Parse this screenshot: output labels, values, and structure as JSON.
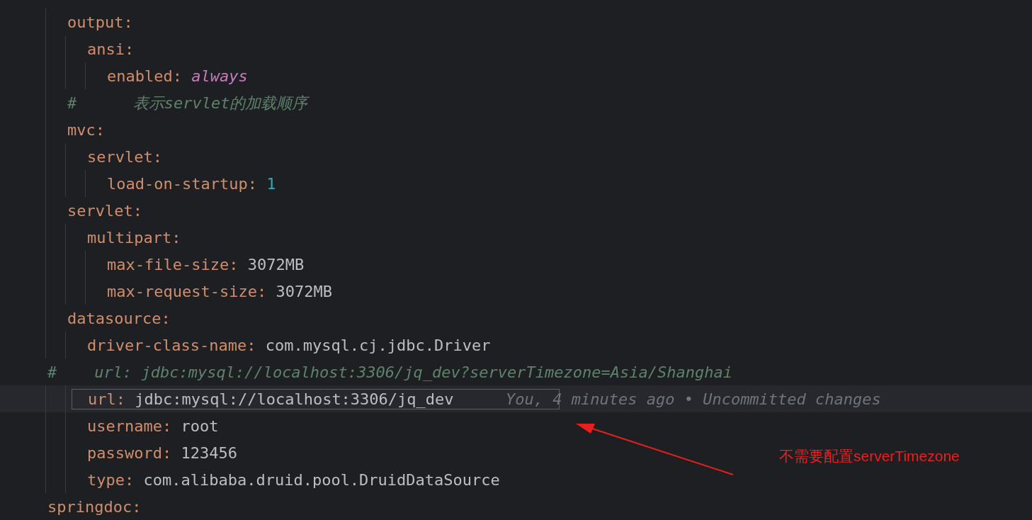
{
  "tree": [
    {
      "children": [
        {
          "key": "output:",
          "children": [
            {
              "key": "ansi:",
              "children": [
                {
                  "kind": "keyword_pair",
                  "key": "enabled:",
                  "value": "always"
                }
              ]
            }
          ]
        },
        {
          "kind": "comment",
          "text": "#      表示servlet的加载顺序"
        },
        {
          "key": "mvc:",
          "children": [
            {
              "key": "servlet:",
              "children": [
                {
                  "kind": "number_pair",
                  "key": "load-on-startup:",
                  "value": "1"
                }
              ]
            }
          ]
        },
        {
          "key": "servlet:",
          "children": [
            {
              "key": "multipart:",
              "children": [
                {
                  "kind": "pair",
                  "key": "max-file-size:",
                  "value": "3072MB"
                },
                {
                  "kind": "pair",
                  "key": "max-request-size:",
                  "value": "3072MB"
                }
              ]
            }
          ]
        },
        {
          "key": "datasource:",
          "children": [
            {
              "kind": "pair",
              "key": "driver-class-name:",
              "value": "com.mysql.cj.jdbc.Driver"
            },
            {
              "kind": "margin_comment",
              "text": "#    url: jdbc:mysql://localhost:3306/jq_dev?serverTimezone=Asia/Shanghai"
            },
            {
              "kind": "pair",
              "key": "url:",
              "value": "jdbc:mysql://localhost:3306/jq_dev",
              "current": true,
              "blame": "You, 4 minutes ago • Uncommitted changes"
            },
            {
              "kind": "pair",
              "key": "username:",
              "value": "root"
            },
            {
              "kind": "pair",
              "key": "password:",
              "value": "123456"
            },
            {
              "kind": "pair",
              "key": "type:",
              "value": "com.alibaba.druid.pool.DruidDataSource"
            }
          ]
        }
      ]
    },
    {
      "key": "springdoc:"
    }
  ],
  "annotation": {
    "note": "不需要配置serverTimezone"
  }
}
